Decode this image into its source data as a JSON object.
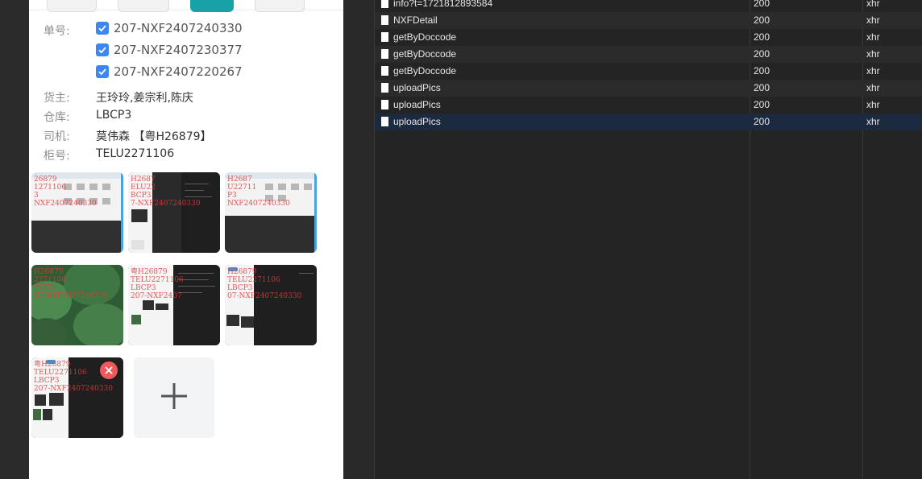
{
  "form": {
    "order_label": "单号:",
    "orders": [
      "207-NXF2407240330",
      "207-NXF2407230377",
      "207-NXF2407220267"
    ],
    "owner_label": "货主:",
    "owner_value": "王玲玲,姜宗利,陈庆",
    "warehouse_label": "仓库:",
    "warehouse_value": "LBCP3",
    "driver_label": "司机:",
    "driver_value": "莫伟森 【粤H26879】",
    "container_label": "柜号:",
    "container_value": "TELU2271106"
  },
  "watermarks": {
    "wm1": "26879\n1271106\n3\nNXF2407240330",
    "wm2": "H2687\nELU22\nBCP3\n7-NXF2407240330",
    "wm3": "H2687\nU22711\nP3\nNXF2407240330",
    "wm4": "H26879\n2271106\nBCP3\n07-NXF2407240330",
    "wm5": "粤H26879\nTELU2271106\nLBCP3\n207-NXF2407",
    "wm6": "H26879\nTELU2271106\nLBCP3\n07-NXF2407240330",
    "wm7": "粤H26879\nTELU2271106\nLBCP3\n207-NXF2407240330"
  },
  "icons": {
    "checkbox": "check-icon",
    "remove": "close-circle-icon",
    "add": "plus-icon",
    "file": "document-icon"
  },
  "colors": {
    "checkbox": "#3c86f5",
    "remove": "#ee5a5a",
    "selected_row": "#1c2a40"
  },
  "network": {
    "rows": [
      {
        "name": "info?t=1721812893584",
        "status": "200",
        "type": "xhr"
      },
      {
        "name": "NXFDetail",
        "status": "200",
        "type": "xhr"
      },
      {
        "name": "getByDoccode",
        "status": "200",
        "type": "xhr"
      },
      {
        "name": "getByDoccode",
        "status": "200",
        "type": "xhr"
      },
      {
        "name": "getByDoccode",
        "status": "200",
        "type": "xhr"
      },
      {
        "name": "uploadPics",
        "status": "200",
        "type": "xhr"
      },
      {
        "name": "uploadPics",
        "status": "200",
        "type": "xhr"
      },
      {
        "name": "uploadPics",
        "status": "200",
        "type": "xhr"
      }
    ]
  }
}
